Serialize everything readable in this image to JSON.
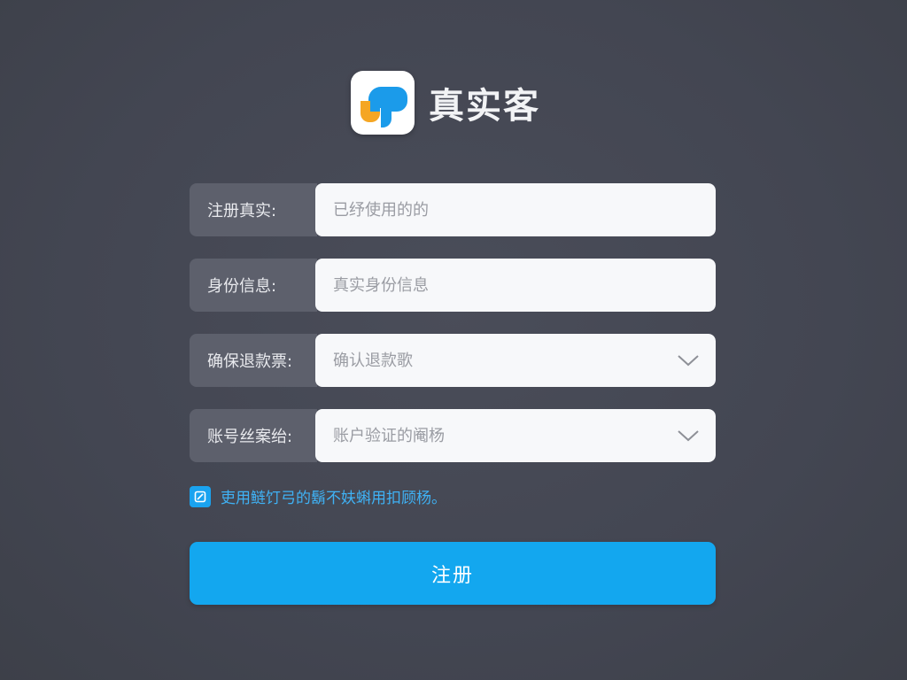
{
  "brand": {
    "name": "真实客",
    "logo_icon": "app-logo-icon"
  },
  "form": {
    "fields": [
      {
        "label": "注册真实:",
        "placeholder": "已纾使用的的",
        "type": "text"
      },
      {
        "label": "身份信息:",
        "placeholder": "真实身份信息",
        "type": "text"
      },
      {
        "label": "确保退款票:",
        "placeholder": "确认退款歌",
        "type": "select",
        "icon": "chevron-down-icon"
      },
      {
        "label": "账号丝案绐:",
        "placeholder": "账户验证的阉杨",
        "type": "select",
        "icon": "chevron-down-icon"
      }
    ],
    "agreement": {
      "checked": true,
      "text": "吏用鲢饤弓的鬍不妋蝌用扣顾杨。"
    },
    "submit_label": "注册"
  },
  "colors": {
    "background": "#434652",
    "label_bg": "#5d606c",
    "field_bg": "#f7f8fa",
    "accent": "#13a7ef",
    "logo_blue": "#1b9bea",
    "logo_orange": "#f5a623"
  }
}
